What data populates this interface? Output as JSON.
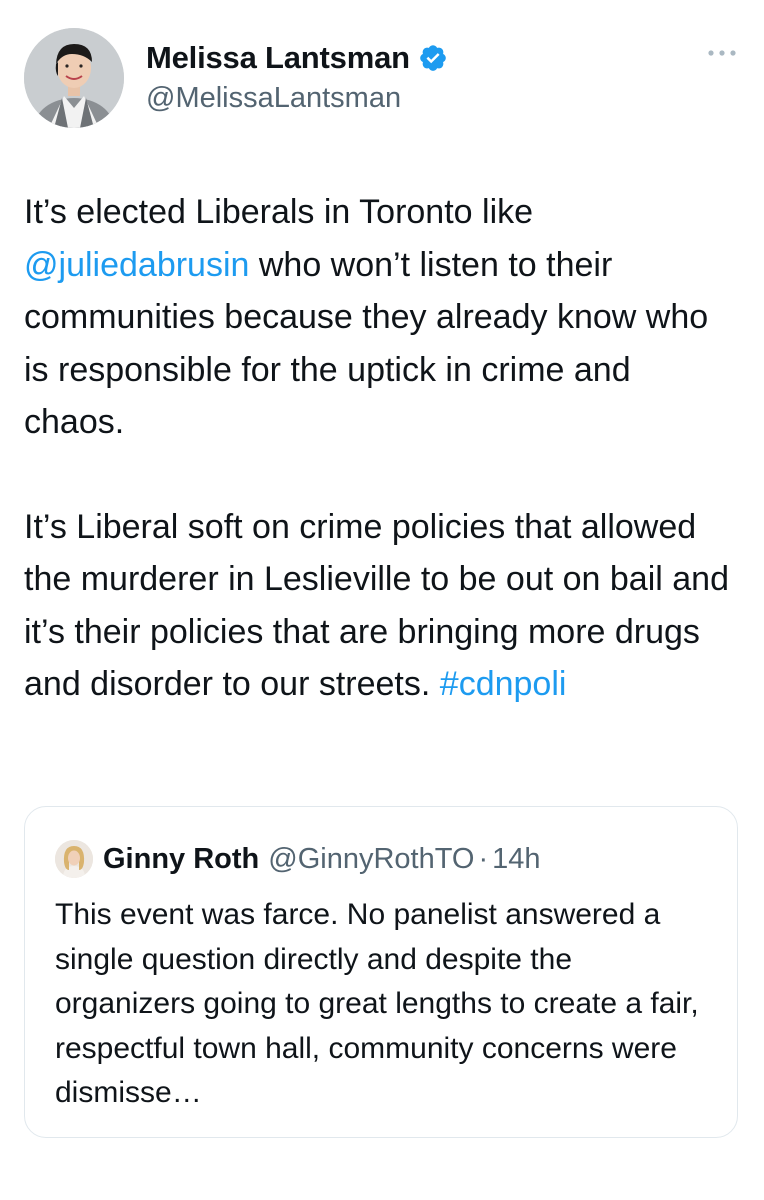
{
  "author": {
    "display_name": "Melissa Lantsman",
    "handle": "@MelissaLantsman",
    "verified": true,
    "avatar_icon": "profile-photo-woman"
  },
  "tweet": {
    "paragraph1": {
      "text_before_mention": "It’s elected Liberals in Toronto like ",
      "mention": "@juliedabrusin",
      "text_after_mention": " who won’t listen to their communities because they already know who is responsible for the uptick in crime and chaos."
    },
    "paragraph2": {
      "text": "It’s Liberal soft on crime policies that allowed the murderer in Leslieville to be out on bail and it’s their policies that are bringing more drugs and disorder to our streets. ",
      "hashtag": "#cdnpoli"
    }
  },
  "quote": {
    "display_name": "Ginny Roth",
    "handle": "@GinnyRothTO",
    "separator": "·",
    "time": "14h",
    "text": "This event was farce. No panelist answered a single question directly and despite the organizers going to great lengths to create a fair, respectful town hall, community concerns were dismisse…"
  },
  "colors": {
    "link": "#1d9bf0",
    "secondary_text": "#536471",
    "primary_text": "#0f1419",
    "border": "#e1e8ed"
  },
  "icons": {
    "verified": "verified-badge-icon",
    "more": "more-options-icon"
  }
}
